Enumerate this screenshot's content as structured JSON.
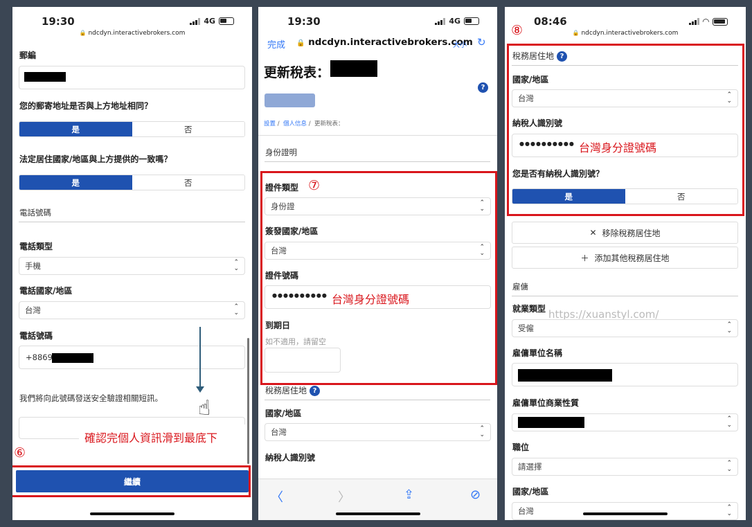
{
  "colors": {
    "accent": "#1f52b0",
    "annotation": "#d9161c",
    "background": "#3b4654"
  },
  "p1": {
    "status": {
      "time": "19:30",
      "network": "4G",
      "url": "ndcdyn.interactivebrokers.com"
    },
    "postal_label": "郵編",
    "same_address_q": "您的郵寄地址是否與上方地址相同？",
    "yes": "是",
    "no": "否",
    "residence_q": "法定居住國家/地區與上方提供的一致嗎？",
    "phone_section": "電話號碼",
    "phone_type_label": "電話類型",
    "phone_type_value": "手機",
    "phone_country_label": "電話國家/地區",
    "phone_country_value": "台灣",
    "phone_number_label": "電話號碼",
    "phone_prefix": "+8869",
    "sms_note": "我們將向此號碼發送安全驗證相關短訊。",
    "step": "⑥",
    "annotation": "確認完個人資訊滑到最底下",
    "continue": "繼續",
    "icons": [
      "chevron-updown-icon",
      "hand-pointer-icon",
      "down-arrow-icon",
      "lock-icon"
    ]
  },
  "p2": {
    "status": {
      "time": "19:30",
      "network": "4G"
    },
    "nav": {
      "done": "完成",
      "url": "ndcdyn.interactivebrokers.com",
      "text_size": "大小",
      "reload": "↻"
    },
    "title": "更新稅表：",
    "breadcrumb": [
      "設置",
      "個人信息",
      "更新稅表："
    ],
    "id_section": "身份證明",
    "step": "⑦",
    "doc_type_label": "證件類型",
    "doc_type_value": "身份證",
    "issuing_country_label": "簽發國家/地區",
    "issuing_country_value": "台灣",
    "doc_number_label": "證件號碼",
    "doc_number_dots": "●●●●●●●●●●",
    "doc_number_note": "台灣身分證號碼",
    "expiry_label": "到期日",
    "expiry_hint": "如不適用，請留空",
    "tax_residence": "稅務居住地",
    "country_label": "國家/地區",
    "country_value": "台灣",
    "tin_label": "納稅人識別號",
    "icons": [
      "back-icon",
      "forward-icon",
      "share-icon",
      "compass-icon",
      "help-icon"
    ]
  },
  "p3": {
    "status": {
      "time": "08:46",
      "url": "ndcdyn.interactivebrokers.com"
    },
    "step": "⑧",
    "tax_residence": "稅務居住地",
    "country_label": "國家/地區",
    "country_value": "台灣",
    "tin_label": "納稅人識別號",
    "tin_dots": "●●●●●●●●●●",
    "tin_note": "台灣身分證號碼",
    "has_tin_q": "您是否有納稅人識別號？",
    "yes": "是",
    "no": "否",
    "remove": "移除稅務居住地",
    "add": "添加其他稅務居住地",
    "employment": "雇傭",
    "emp_type_label": "就業類型",
    "emp_type_value": "受僱",
    "watermark": "https://xuanstyl.com/",
    "employer_label": "雇傭單位名稱",
    "employer_business_label": "雇傭單位商業性質",
    "position_label": "職位",
    "position_value": "請選擇",
    "country_label2": "國家/地區",
    "country_value2": "台灣"
  }
}
